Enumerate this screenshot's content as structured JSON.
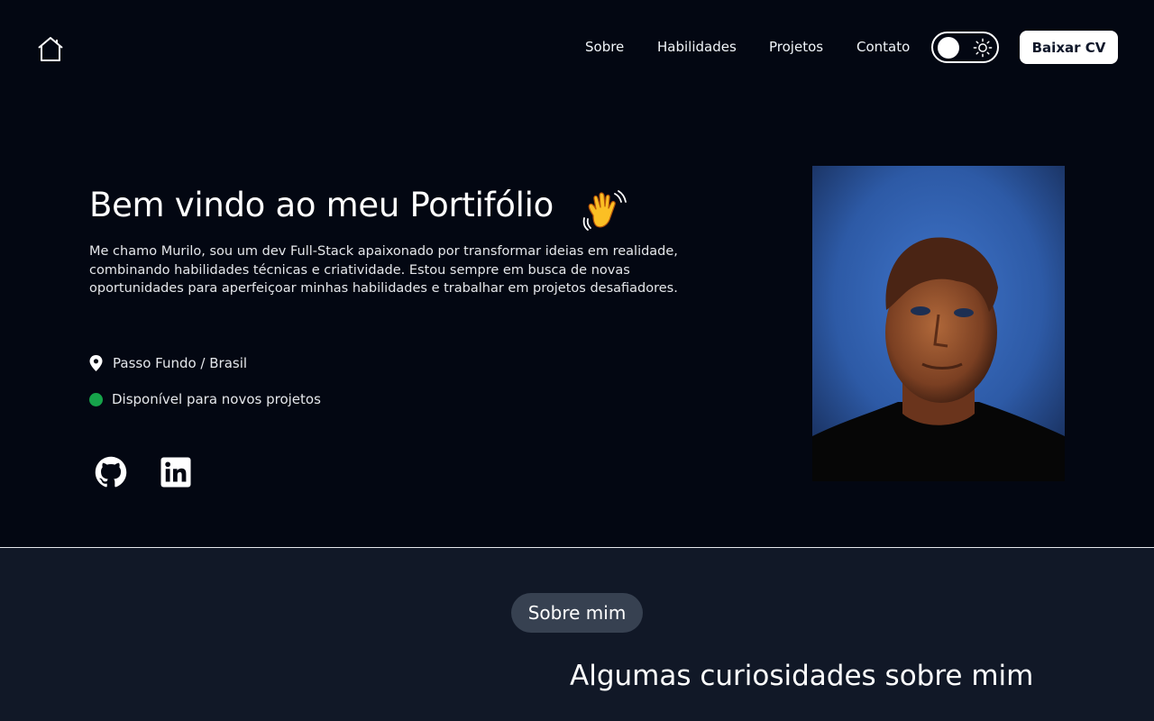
{
  "header": {
    "nav": [
      {
        "label": "Sobre"
      },
      {
        "label": "Habilidades"
      },
      {
        "label": "Projetos"
      },
      {
        "label": "Contato"
      }
    ],
    "cv_button": "Baixar CV",
    "theme": "dark"
  },
  "hero": {
    "title": "Bem vindo ao meu Portifólio",
    "description": "Me chamo Murilo, sou um dev Full-Stack apaixonado por transformar ideias em realidade, combinando habilidades técnicas e criatividade. Estou sempre em busca de novas oportunidades para aperfeiçoar minhas habilidades e trabalhar em projetos desafiadores.",
    "location": "Passo Fundo / Brasil",
    "status": "Disponível para novos projetos",
    "status_color": "#16a34a",
    "social_icons": [
      "github-icon",
      "linkedin-icon"
    ]
  },
  "about": {
    "badge": "Sobre mim",
    "heading": "Algumas curiosidades sobre mim"
  },
  "colors": {
    "background": "#030712",
    "section_background": "#111827",
    "badge_background": "#374151",
    "accent": "#ffffff"
  }
}
